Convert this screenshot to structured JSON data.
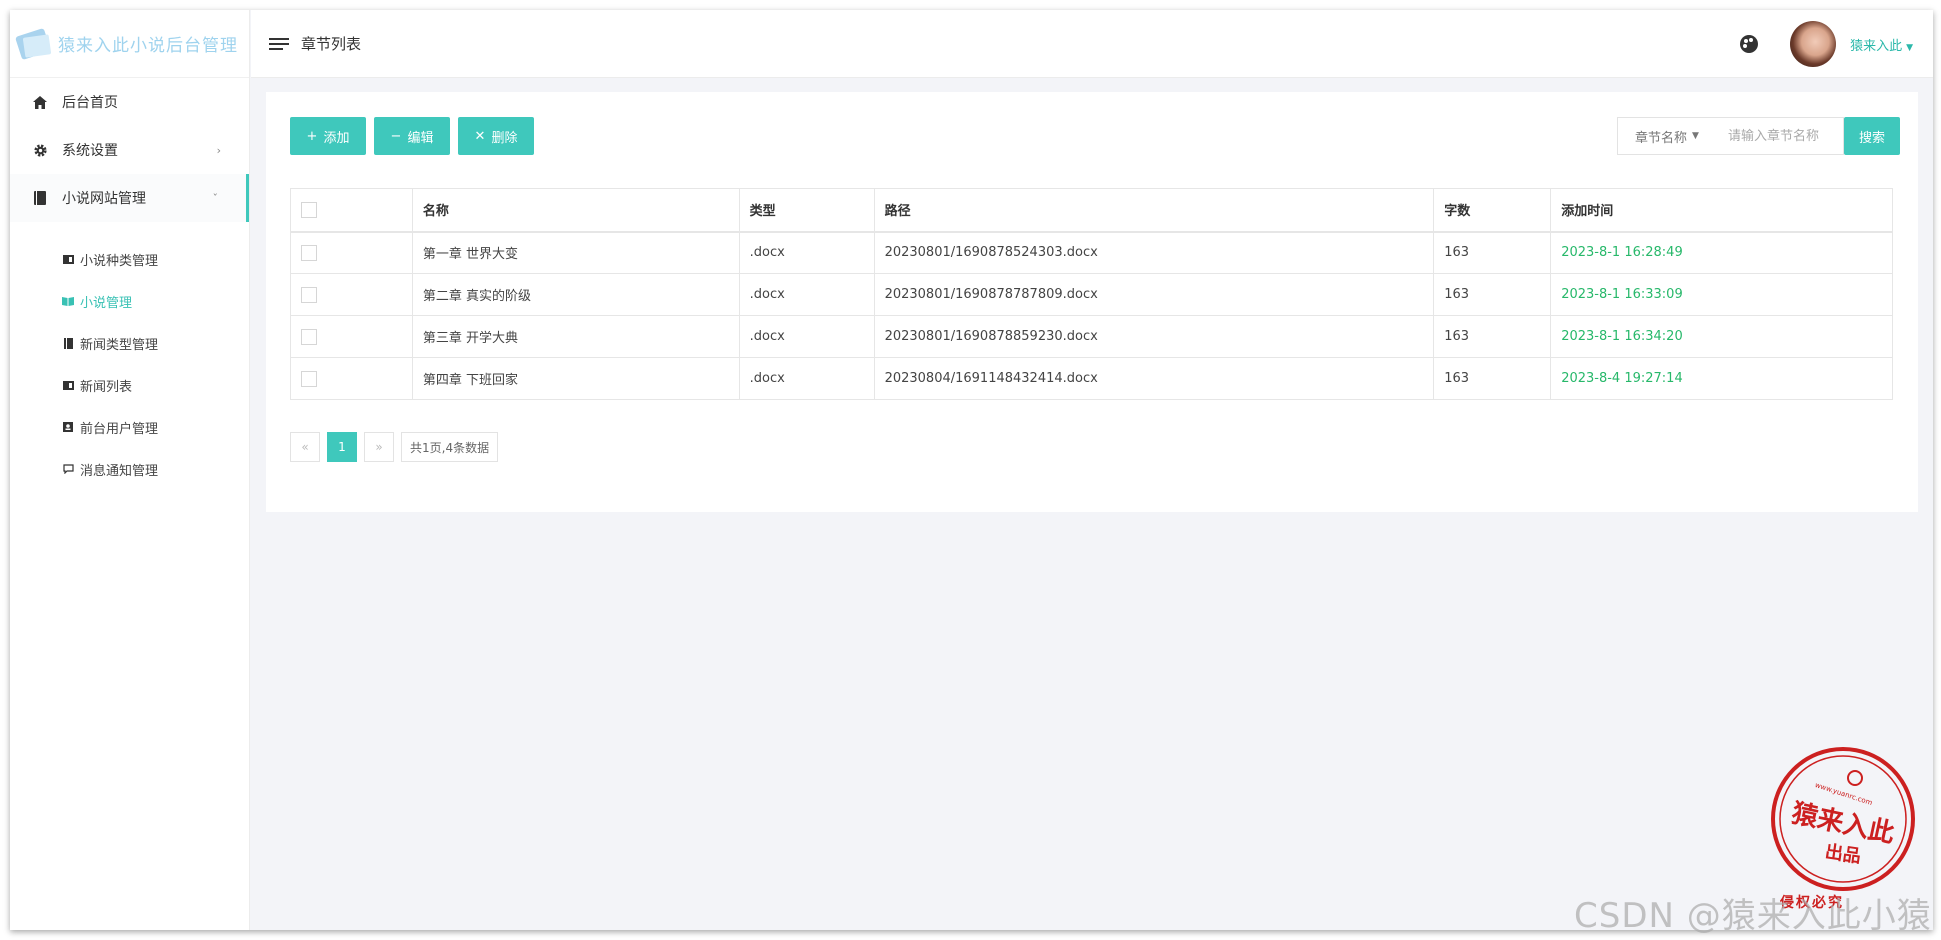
{
  "sidebar": {
    "logo_text": "猿来入此小说后台管理",
    "items": [
      {
        "label": "后台首页",
        "icon": "home-icon"
      },
      {
        "label": "系统设置",
        "icon": "gear-icon"
      },
      {
        "label": "小说网站管理",
        "icon": "book-icon"
      }
    ],
    "subitems": [
      {
        "label": "小说种类管理",
        "icon": "idcard-icon"
      },
      {
        "label": "小说管理",
        "icon": "open-book-icon"
      },
      {
        "label": "新闻类型管理",
        "icon": "bookmark-icon"
      },
      {
        "label": "新闻列表",
        "icon": "idcard-icon"
      },
      {
        "label": "前台用户管理",
        "icon": "user-card-icon"
      },
      {
        "label": "消息通知管理",
        "icon": "comment-icon"
      }
    ]
  },
  "header": {
    "page_title": "章节列表",
    "user_name": "猿来入此"
  },
  "toolbar": {
    "add_label": "添加",
    "edit_label": "编辑",
    "delete_label": "删除",
    "search_field_label": "章节名称",
    "search_placeholder": "请输入章节名称",
    "search_button": "搜索"
  },
  "table": {
    "headers": [
      "名称",
      "类型",
      "路径",
      "字数",
      "添加时间"
    ],
    "rows": [
      {
        "name": "第一章 世界大变",
        "type": ".docx",
        "path": "20230801/1690878524303.docx",
        "words": "163",
        "time": "2023-8-1 16:28:49"
      },
      {
        "name": "第二章 真实的阶级",
        "type": ".docx",
        "path": "20230801/1690878787809.docx",
        "words": "163",
        "time": "2023-8-1 16:33:09"
      },
      {
        "name": "第三章 开学大典",
        "type": ".docx",
        "path": "20230801/1690878859230.docx",
        "words": "163",
        "time": "2023-8-1 16:34:20"
      },
      {
        "name": "第四章 下班回家",
        "type": ".docx",
        "path": "20230804/1691148432414.docx",
        "words": "163",
        "time": "2023-8-4 19:27:14"
      }
    ]
  },
  "pager": {
    "prev": "«",
    "current": "1",
    "next": "»",
    "info": "共1页,4条数据"
  },
  "stamp": {
    "main": "猿来入此",
    "sub": "出品",
    "url": "www.yuanrc.com",
    "bottom": "侵权必究"
  },
  "watermark": "CSDN @猿来入此小猿",
  "colors": {
    "accent": "#3fc8bc",
    "time_text": "#27b86a",
    "logo_text": "#9fd3ee"
  }
}
